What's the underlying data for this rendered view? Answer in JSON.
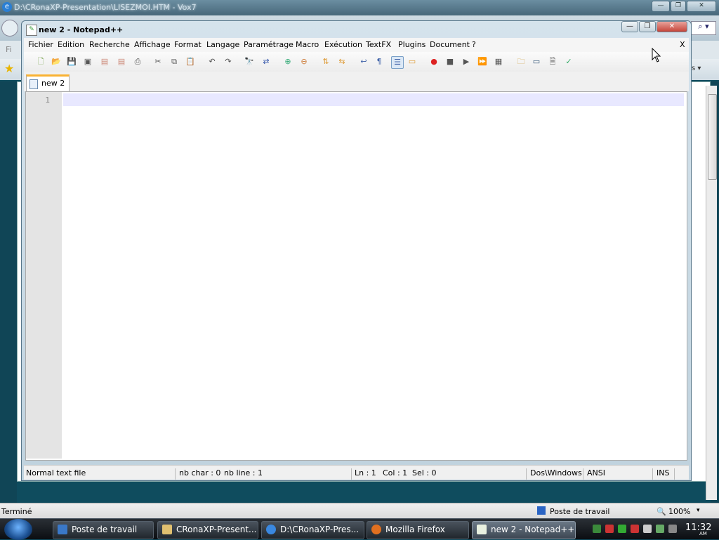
{
  "ie": {
    "title": "D:\\CRonaXP-Presentation\\LISEZMOI.HTM - Vox7",
    "status_left": "Terminé",
    "status_zone": "Poste de travail",
    "zoom": "100%"
  },
  "npp": {
    "title": "new 2 - Notepad++",
    "close_doc": "X",
    "menu": [
      "Fichier",
      "Edition",
      "Recherche",
      "Affichage",
      "Format",
      "Langage",
      "Paramétrage",
      "Macro",
      "Exécution",
      "TextFX",
      "Plugins",
      "Document",
      "?"
    ],
    "tab_label": "new 2",
    "line_number": "1",
    "status": {
      "file_type": "Normal text file",
      "nb_char": "nb char : 0",
      "nb_line": "nb line : 1",
      "ln": "Ln : 1",
      "col": "Col : 1",
      "sel": "Sel : 0",
      "eol": "Dos\\Windows",
      "encoding": "ANSI",
      "ins": "INS"
    },
    "toolbar_icons": [
      "new-file-icon",
      "open-file-icon",
      "save-icon",
      "save-all-icon",
      "close-icon",
      "close-all-icon",
      "print-icon",
      "cut-icon",
      "copy-icon",
      "paste-icon",
      "undo-icon",
      "redo-icon",
      "find-icon",
      "replace-icon",
      "zoom-in-icon",
      "zoom-out-icon",
      "sync-v-icon",
      "sync-h-icon",
      "word-wrap-icon",
      "show-all-chars-icon",
      "indent-guide-icon",
      "user-lang-icon",
      "record-macro-icon",
      "stop-record-icon",
      "play-macro-icon",
      "run-macro-multiple-icon",
      "save-macro-icon",
      "open-folder-icon",
      "console-icon",
      "preview-icon",
      "spellcheck-icon"
    ]
  },
  "taskbar": {
    "items": [
      {
        "label": "Poste de travail",
        "icon": "computer-icon"
      },
      {
        "label": "CRonaXP-Present...",
        "icon": "folder-icon"
      },
      {
        "label": "D:\\CRonaXP-Pres...",
        "icon": "ie-icon"
      },
      {
        "label": "Mozilla Firefox",
        "icon": "firefox-icon"
      },
      {
        "label": "new 2 - Notepad++",
        "icon": "notepadpp-icon"
      }
    ],
    "clock": "11:32",
    "ampm": "AM"
  }
}
